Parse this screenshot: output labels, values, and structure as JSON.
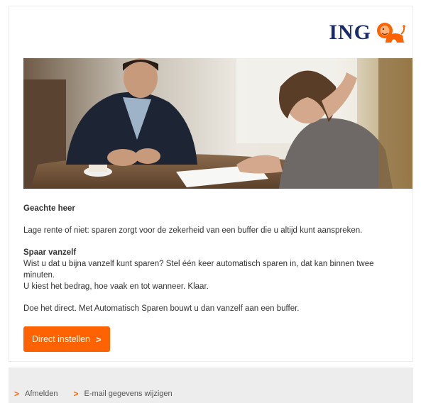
{
  "brand": {
    "name": "ING",
    "logo_icon": "lion-icon",
    "accent_color": "#ff6200",
    "logo_text_color": "#1b2a6b"
  },
  "hero": {
    "image": "two-people-at-table-photo"
  },
  "body": {
    "greeting": "Geachte heer",
    "intro": "Lage rente of niet: sparen zorgt voor de zekerheid van een buffer die u altijd kunt aanspreken.",
    "subheading": "Spaar vanzelf",
    "paragraph_line1": "Wist u dat u bijna vanzelf kunt sparen? Stel één keer automatisch sparen in, dat kan binnen twee minuten.",
    "paragraph_line2": "U kiest het bedrag, hoe vaak en tot wanneer. Klaar.",
    "closing": "Doe het direct. Met Automatisch Sparen bouwt u dan vanzelf aan een buffer."
  },
  "cta": {
    "label": "Direct instellen",
    "arrow": ">"
  },
  "footer": {
    "links": [
      {
        "label": "Afmelden",
        "icon": "chevron-right-icon"
      },
      {
        "label": "E-mail gegevens wijzigen",
        "icon": "chevron-right-icon"
      }
    ]
  }
}
